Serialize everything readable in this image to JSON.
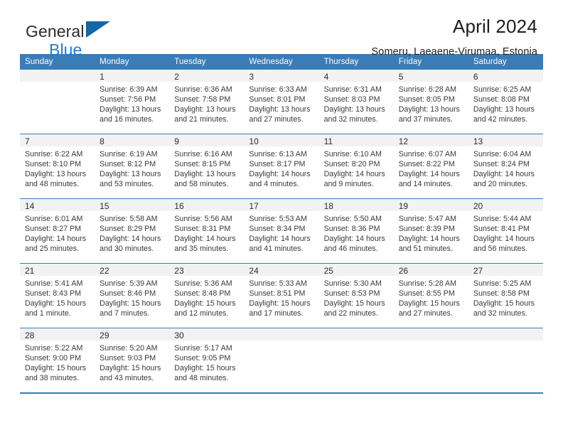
{
  "brand": {
    "name_part1": "General",
    "name_part2": "Blue",
    "triangle_color": "#1565a8",
    "blue_text_color": "#1a7fd4"
  },
  "header": {
    "title": "April 2024",
    "subtitle": "Someru, Laeaene-Virumaa, Estonia"
  },
  "theme": {
    "header_bg": "#3a7cb8",
    "daynum_bg": "#f2f2f2",
    "rule_color": "#3a7cb8",
    "text_color": "#3a3a3a"
  },
  "weekday_headers": [
    "Sunday",
    "Monday",
    "Tuesday",
    "Wednesday",
    "Thursday",
    "Friday",
    "Saturday"
  ],
  "weeks": [
    [
      {
        "day": "",
        "sunrise": "",
        "sunset": "",
        "daylight_line1": "",
        "daylight_line2": "",
        "empty": true
      },
      {
        "day": "1",
        "sunrise": "Sunrise: 6:39 AM",
        "sunset": "Sunset: 7:56 PM",
        "daylight_line1": "Daylight: 13 hours",
        "daylight_line2": "and 16 minutes.",
        "empty": false
      },
      {
        "day": "2",
        "sunrise": "Sunrise: 6:36 AM",
        "sunset": "Sunset: 7:58 PM",
        "daylight_line1": "Daylight: 13 hours",
        "daylight_line2": "and 21 minutes.",
        "empty": false
      },
      {
        "day": "3",
        "sunrise": "Sunrise: 6:33 AM",
        "sunset": "Sunset: 8:01 PM",
        "daylight_line1": "Daylight: 13 hours",
        "daylight_line2": "and 27 minutes.",
        "empty": false
      },
      {
        "day": "4",
        "sunrise": "Sunrise: 6:31 AM",
        "sunset": "Sunset: 8:03 PM",
        "daylight_line1": "Daylight: 13 hours",
        "daylight_line2": "and 32 minutes.",
        "empty": false
      },
      {
        "day": "5",
        "sunrise": "Sunrise: 6:28 AM",
        "sunset": "Sunset: 8:05 PM",
        "daylight_line1": "Daylight: 13 hours",
        "daylight_line2": "and 37 minutes.",
        "empty": false
      },
      {
        "day": "6",
        "sunrise": "Sunrise: 6:25 AM",
        "sunset": "Sunset: 8:08 PM",
        "daylight_line1": "Daylight: 13 hours",
        "daylight_line2": "and 42 minutes.",
        "empty": false
      }
    ],
    [
      {
        "day": "7",
        "sunrise": "Sunrise: 6:22 AM",
        "sunset": "Sunset: 8:10 PM",
        "daylight_line1": "Daylight: 13 hours",
        "daylight_line2": "and 48 minutes.",
        "empty": false
      },
      {
        "day": "8",
        "sunrise": "Sunrise: 6:19 AM",
        "sunset": "Sunset: 8:12 PM",
        "daylight_line1": "Daylight: 13 hours",
        "daylight_line2": "and 53 minutes.",
        "empty": false
      },
      {
        "day": "9",
        "sunrise": "Sunrise: 6:16 AM",
        "sunset": "Sunset: 8:15 PM",
        "daylight_line1": "Daylight: 13 hours",
        "daylight_line2": "and 58 minutes.",
        "empty": false
      },
      {
        "day": "10",
        "sunrise": "Sunrise: 6:13 AM",
        "sunset": "Sunset: 8:17 PM",
        "daylight_line1": "Daylight: 14 hours",
        "daylight_line2": "and 4 minutes.",
        "empty": false
      },
      {
        "day": "11",
        "sunrise": "Sunrise: 6:10 AM",
        "sunset": "Sunset: 8:20 PM",
        "daylight_line1": "Daylight: 14 hours",
        "daylight_line2": "and 9 minutes.",
        "empty": false
      },
      {
        "day": "12",
        "sunrise": "Sunrise: 6:07 AM",
        "sunset": "Sunset: 8:22 PM",
        "daylight_line1": "Daylight: 14 hours",
        "daylight_line2": "and 14 minutes.",
        "empty": false
      },
      {
        "day": "13",
        "sunrise": "Sunrise: 6:04 AM",
        "sunset": "Sunset: 8:24 PM",
        "daylight_line1": "Daylight: 14 hours",
        "daylight_line2": "and 20 minutes.",
        "empty": false
      }
    ],
    [
      {
        "day": "14",
        "sunrise": "Sunrise: 6:01 AM",
        "sunset": "Sunset: 8:27 PM",
        "daylight_line1": "Daylight: 14 hours",
        "daylight_line2": "and 25 minutes.",
        "empty": false
      },
      {
        "day": "15",
        "sunrise": "Sunrise: 5:58 AM",
        "sunset": "Sunset: 8:29 PM",
        "daylight_line1": "Daylight: 14 hours",
        "daylight_line2": "and 30 minutes.",
        "empty": false
      },
      {
        "day": "16",
        "sunrise": "Sunrise: 5:56 AM",
        "sunset": "Sunset: 8:31 PM",
        "daylight_line1": "Daylight: 14 hours",
        "daylight_line2": "and 35 minutes.",
        "empty": false
      },
      {
        "day": "17",
        "sunrise": "Sunrise: 5:53 AM",
        "sunset": "Sunset: 8:34 PM",
        "daylight_line1": "Daylight: 14 hours",
        "daylight_line2": "and 41 minutes.",
        "empty": false
      },
      {
        "day": "18",
        "sunrise": "Sunrise: 5:50 AM",
        "sunset": "Sunset: 8:36 PM",
        "daylight_line1": "Daylight: 14 hours",
        "daylight_line2": "and 46 minutes.",
        "empty": false
      },
      {
        "day": "19",
        "sunrise": "Sunrise: 5:47 AM",
        "sunset": "Sunset: 8:39 PM",
        "daylight_line1": "Daylight: 14 hours",
        "daylight_line2": "and 51 minutes.",
        "empty": false
      },
      {
        "day": "20",
        "sunrise": "Sunrise: 5:44 AM",
        "sunset": "Sunset: 8:41 PM",
        "daylight_line1": "Daylight: 14 hours",
        "daylight_line2": "and 56 minutes.",
        "empty": false
      }
    ],
    [
      {
        "day": "21",
        "sunrise": "Sunrise: 5:41 AM",
        "sunset": "Sunset: 8:43 PM",
        "daylight_line1": "Daylight: 15 hours",
        "daylight_line2": "and 1 minute.",
        "empty": false
      },
      {
        "day": "22",
        "sunrise": "Sunrise: 5:39 AM",
        "sunset": "Sunset: 8:46 PM",
        "daylight_line1": "Daylight: 15 hours",
        "daylight_line2": "and 7 minutes.",
        "empty": false
      },
      {
        "day": "23",
        "sunrise": "Sunrise: 5:36 AM",
        "sunset": "Sunset: 8:48 PM",
        "daylight_line1": "Daylight: 15 hours",
        "daylight_line2": "and 12 minutes.",
        "empty": false
      },
      {
        "day": "24",
        "sunrise": "Sunrise: 5:33 AM",
        "sunset": "Sunset: 8:51 PM",
        "daylight_line1": "Daylight: 15 hours",
        "daylight_line2": "and 17 minutes.",
        "empty": false
      },
      {
        "day": "25",
        "sunrise": "Sunrise: 5:30 AM",
        "sunset": "Sunset: 8:53 PM",
        "daylight_line1": "Daylight: 15 hours",
        "daylight_line2": "and 22 minutes.",
        "empty": false
      },
      {
        "day": "26",
        "sunrise": "Sunrise: 5:28 AM",
        "sunset": "Sunset: 8:55 PM",
        "daylight_line1": "Daylight: 15 hours",
        "daylight_line2": "and 27 minutes.",
        "empty": false
      },
      {
        "day": "27",
        "sunrise": "Sunrise: 5:25 AM",
        "sunset": "Sunset: 8:58 PM",
        "daylight_line1": "Daylight: 15 hours",
        "daylight_line2": "and 32 minutes.",
        "empty": false
      }
    ],
    [
      {
        "day": "28",
        "sunrise": "Sunrise: 5:22 AM",
        "sunset": "Sunset: 9:00 PM",
        "daylight_line1": "Daylight: 15 hours",
        "daylight_line2": "and 38 minutes.",
        "empty": false
      },
      {
        "day": "29",
        "sunrise": "Sunrise: 5:20 AM",
        "sunset": "Sunset: 9:03 PM",
        "daylight_line1": "Daylight: 15 hours",
        "daylight_line2": "and 43 minutes.",
        "empty": false
      },
      {
        "day": "30",
        "sunrise": "Sunrise: 5:17 AM",
        "sunset": "Sunset: 9:05 PM",
        "daylight_line1": "Daylight: 15 hours",
        "daylight_line2": "and 48 minutes.",
        "empty": false
      },
      {
        "day": "",
        "sunrise": "",
        "sunset": "",
        "daylight_line1": "",
        "daylight_line2": "",
        "empty": true
      },
      {
        "day": "",
        "sunrise": "",
        "sunset": "",
        "daylight_line1": "",
        "daylight_line2": "",
        "empty": true
      },
      {
        "day": "",
        "sunrise": "",
        "sunset": "",
        "daylight_line1": "",
        "daylight_line2": "",
        "empty": true
      },
      {
        "day": "",
        "sunrise": "",
        "sunset": "",
        "daylight_line1": "",
        "daylight_line2": "",
        "empty": true
      }
    ]
  ]
}
